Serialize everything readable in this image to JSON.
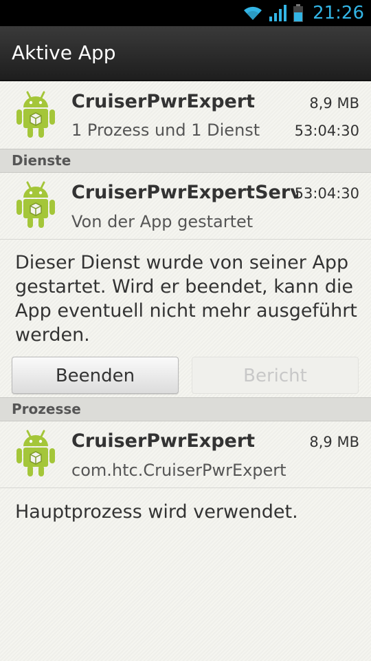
{
  "status_bar": {
    "time": "21:26",
    "icons": [
      "wifi-icon",
      "signal-icon",
      "battery-icon"
    ]
  },
  "action_bar": {
    "title": "Aktive App"
  },
  "app_header": {
    "name": "CruiserPwrExpert",
    "size": "8,9 MB",
    "summary": "1 Prozess und 1 Dienst",
    "uptime": "53:04:30"
  },
  "services_section": {
    "header": "Dienste",
    "item": {
      "name": "CruiserPwrExpertService",
      "uptime": "53:04:30",
      "status": "Von der App gestartet"
    },
    "description": "Dieser Dienst wurde von seiner App gestartet. Wird er beendet, kann die App eventuell nicht mehr ausgeführt werden.",
    "stop_button": "Beenden",
    "report_button": "Bericht"
  },
  "processes_section": {
    "header": "Prozesse",
    "item": {
      "name": "CruiserPwrExpert",
      "size": "8,9 MB",
      "package": "com.htc.CruiserPwrExpert"
    },
    "description": "Hauptprozess wird verwendet."
  },
  "colors": {
    "accent": "#33b5e5",
    "android_green": "#a4c639"
  }
}
